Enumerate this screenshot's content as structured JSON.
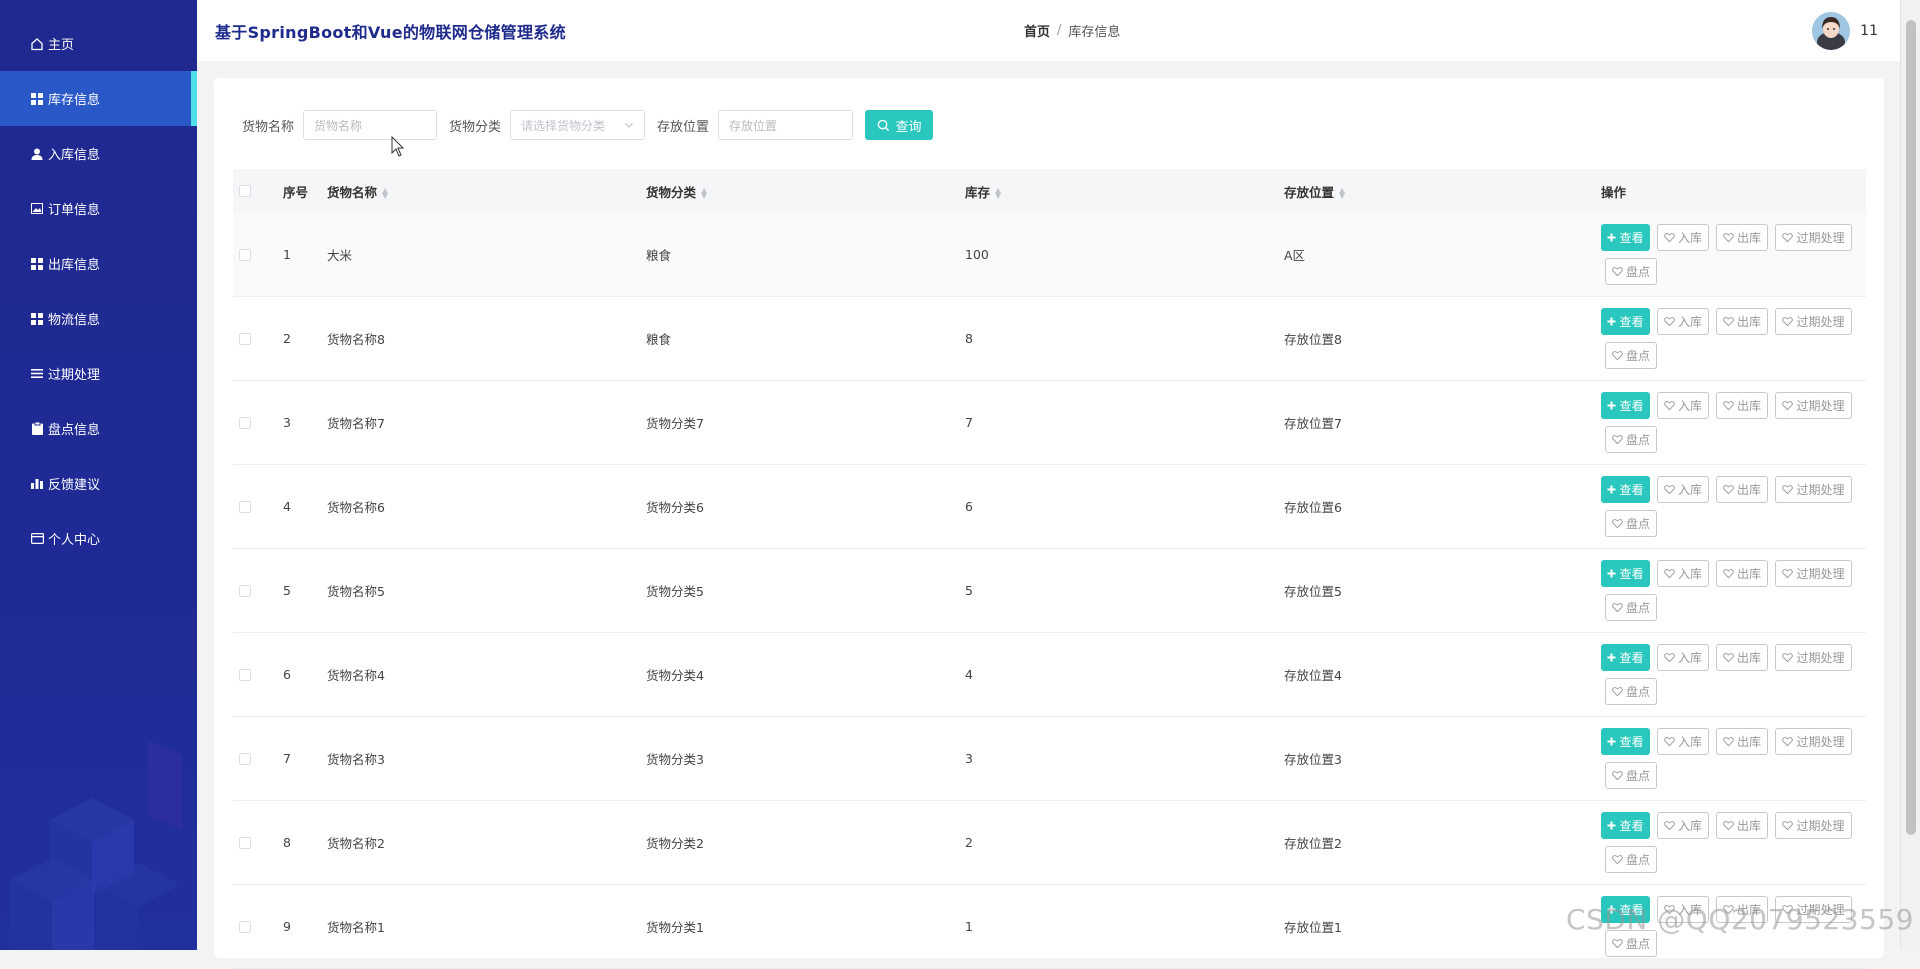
{
  "header": {
    "title": "基于SpringBoot和Vue的物联网仓储管理系统",
    "breadcrumb_home": "首页",
    "breadcrumb_sep": "/",
    "breadcrumb_current": "库存信息",
    "username": "11"
  },
  "sidebar": {
    "items": [
      {
        "label": "主页",
        "icon": "home-icon"
      },
      {
        "label": "库存信息",
        "icon": "grid-icon",
        "active": true
      },
      {
        "label": "入库信息",
        "icon": "user-icon"
      },
      {
        "label": "订单信息",
        "icon": "image-icon"
      },
      {
        "label": "出库信息",
        "icon": "grid-icon"
      },
      {
        "label": "物流信息",
        "icon": "grid-icon"
      },
      {
        "label": "过期处理",
        "icon": "list-icon"
      },
      {
        "label": "盘点信息",
        "icon": "clipboard-icon"
      },
      {
        "label": "反馈建议",
        "icon": "bar-chart-icon"
      },
      {
        "label": "个人中心",
        "icon": "card-icon"
      }
    ]
  },
  "search": {
    "name_label": "货物名称",
    "name_placeholder": "货物名称",
    "category_label": "货物分类",
    "category_placeholder": "请选择货物分类",
    "location_label": "存放位置",
    "location_placeholder": "存放位置",
    "query_button": "查询"
  },
  "table": {
    "headers": [
      "序号",
      "货物名称",
      "货物分类",
      "库存",
      "存放位置",
      "操作"
    ],
    "rows": [
      {
        "index": "1",
        "name": "大米",
        "category": "粮食",
        "stock": "100",
        "location": "A区"
      },
      {
        "index": "2",
        "name": "货物名称8",
        "category": "粮食",
        "stock": "8",
        "location": "存放位置8"
      },
      {
        "index": "3",
        "name": "货物名称7",
        "category": "货物分类7",
        "stock": "7",
        "location": "存放位置7"
      },
      {
        "index": "4",
        "name": "货物名称6",
        "category": "货物分类6",
        "stock": "6",
        "location": "存放位置6"
      },
      {
        "index": "5",
        "name": "货物名称5",
        "category": "货物分类5",
        "stock": "5",
        "location": "存放位置5"
      },
      {
        "index": "6",
        "name": "货物名称4",
        "category": "货物分类4",
        "stock": "4",
        "location": "存放位置4"
      },
      {
        "index": "7",
        "name": "货物名称3",
        "category": "货物分类3",
        "stock": "3",
        "location": "存放位置3"
      },
      {
        "index": "8",
        "name": "货物名称2",
        "category": "货物分类2",
        "stock": "2",
        "location": "存放位置2"
      },
      {
        "index": "9",
        "name": "货物名称1",
        "category": "货物分类1",
        "stock": "1",
        "location": "存放位置1"
      }
    ],
    "actions": {
      "view": "查看",
      "stock_in": "入库",
      "stock_out": "出库",
      "expire": "过期处理",
      "inventory": "盘点"
    }
  },
  "watermark": "CSDN @QQ2079523559",
  "colors": {
    "sidebar_bg": "#20298f",
    "sidebar_active": "#2a58c8",
    "accent": "#2ac7bf",
    "title": "#1e2a8c"
  }
}
